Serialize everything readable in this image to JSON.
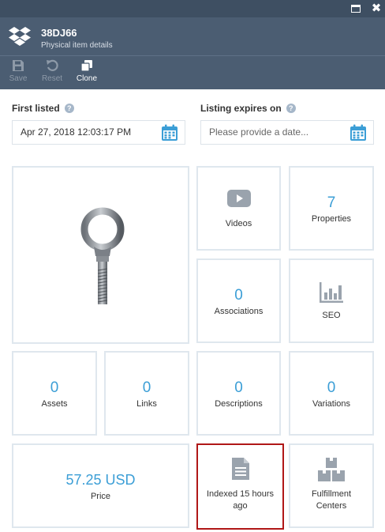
{
  "header": {
    "title": "38DJ66",
    "subtitle": "Physical item details"
  },
  "toolbar": {
    "save_label": "Save",
    "reset_label": "Reset",
    "clone_label": "Clone"
  },
  "fields": {
    "first_listed": {
      "label": "First listed",
      "value": "Apr 27, 2018 12:03:17 PM"
    },
    "listing_expires": {
      "label": "Listing expires on",
      "placeholder": "Please provide a date..."
    }
  },
  "tiles": {
    "videos": {
      "label": "Videos"
    },
    "properties": {
      "count": "7",
      "label": "Properties"
    },
    "associations": {
      "count": "0",
      "label": "Associations"
    },
    "seo": {
      "label": "SEO"
    },
    "assets": {
      "count": "0",
      "label": "Assets"
    },
    "links": {
      "count": "0",
      "label": "Links"
    },
    "descriptions": {
      "count": "0",
      "label": "Descriptions"
    },
    "variations": {
      "count": "0",
      "label": "Variations"
    },
    "price": {
      "value": "57.25 USD",
      "label": "Price"
    },
    "indexed": {
      "label_line1": "Indexed 15 hours",
      "label_line2": "ago"
    },
    "fulfillment": {
      "label_line1": "Fulfillment",
      "label_line2": "Centers"
    }
  },
  "icons": {
    "app_logo": "dropbox-logo-icon",
    "save": "save-icon",
    "reset": "reset-icon",
    "clone": "clone-icon",
    "help": "help-icon",
    "calendar": "calendar-icon",
    "videos": "play-video-icon",
    "seo": "bar-chart-icon",
    "indexed": "document-icon",
    "fulfillment": "boxes-icon"
  },
  "colors": {
    "header_bg": "#4b5d72",
    "titlebar_bg": "#3e4f62",
    "accent": "#3b9ed6",
    "tile_border": "#dfe7ee",
    "highlight_border": "#b01717",
    "icon_gray": "#9aa3ad"
  }
}
